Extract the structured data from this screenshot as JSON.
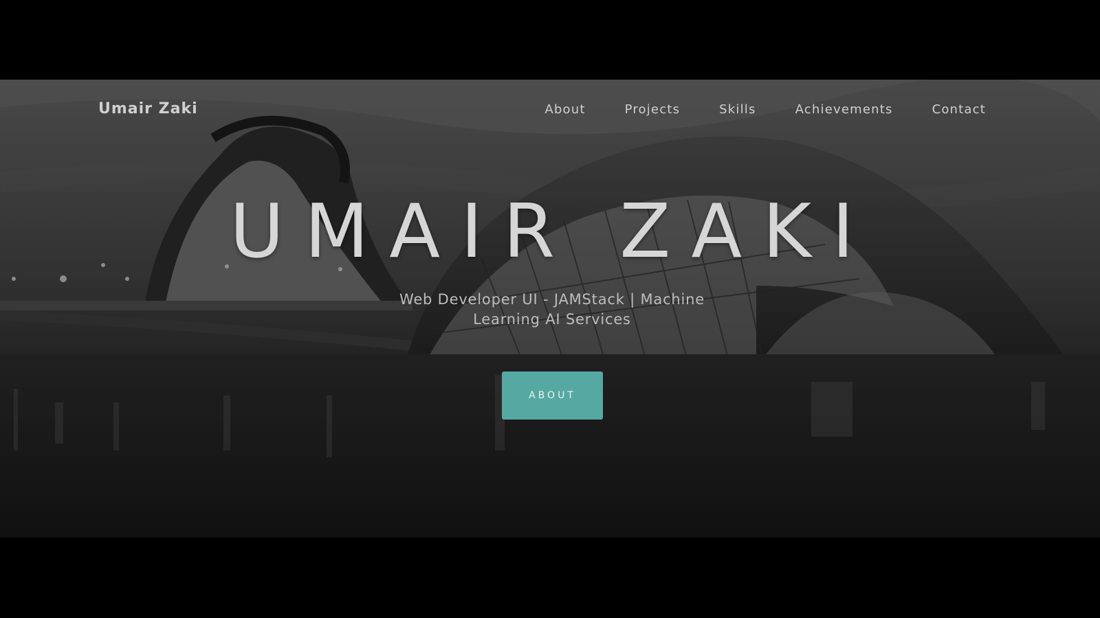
{
  "header": {
    "brand": "Umair Zaki",
    "nav": [
      {
        "label": "About"
      },
      {
        "label": "Projects"
      },
      {
        "label": "Skills"
      },
      {
        "label": "Achievements"
      },
      {
        "label": "Contact"
      }
    ]
  },
  "hero": {
    "title": "UMAIR ZAKI",
    "subtitle": "Web Developer UI - JAMStack | Machine Learning AI Services",
    "cta_label": "ABOUT",
    "background_image": "city-of-arts-and-sciences-night-photo"
  },
  "colors": {
    "accent": "#56a8a2",
    "letterbox": "#000000",
    "nav_text": "#cfcfcf"
  }
}
